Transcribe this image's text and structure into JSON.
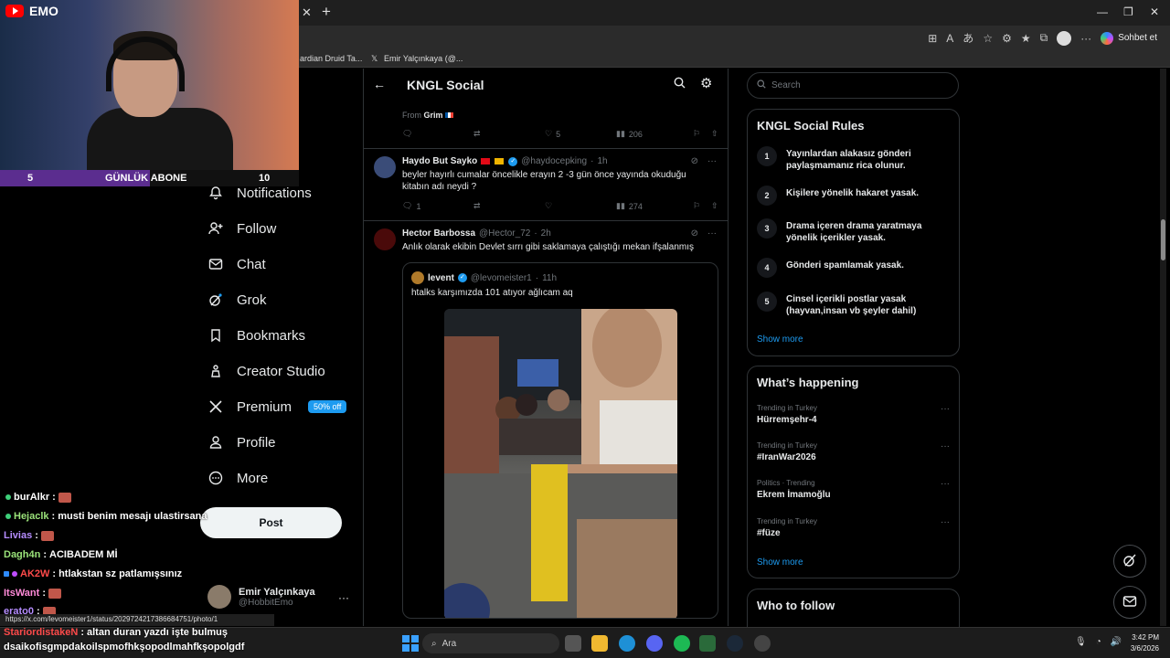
{
  "browser": {
    "tabs": [
      {
        "label": "ardian Druid Ta..."
      },
      {
        "label": "Emir Yalçınkaya (@..."
      }
    ],
    "copilot_label": "Sohbet et",
    "status_url": "https://x.com/levomeister1/status/2029724217386684751/photo/1"
  },
  "nav": {
    "items": [
      {
        "label": "Notifications",
        "icon": "bell-icon"
      },
      {
        "label": "Follow",
        "icon": "person-plus-icon"
      },
      {
        "label": "Chat",
        "icon": "envelope-icon"
      },
      {
        "label": "Grok",
        "icon": "grok-icon"
      },
      {
        "label": "Bookmarks",
        "icon": "bookmark-icon"
      },
      {
        "label": "Creator Studio",
        "icon": "creator-studio-icon"
      },
      {
        "label": "Premium",
        "icon": "x-logo-icon"
      },
      {
        "label": "Profile",
        "icon": "person-icon"
      },
      {
        "label": "More",
        "icon": "more-circle-icon"
      }
    ],
    "premium_badge": "50% off",
    "post_label": "Post",
    "account": {
      "name": "Emir Yalçınkaya",
      "handle": "@HobbitEmo"
    }
  },
  "header": {
    "title": "KNGL Social"
  },
  "feed": {
    "prev_from_label": "From",
    "prev_from_name": "Grim",
    "prev_actions": {
      "replies": "",
      "reposts": "",
      "likes": "5",
      "views": "206"
    },
    "tweets": [
      {
        "name": "Haydo But Sayko",
        "handle": "@haydocepking",
        "time": "1h",
        "text": "beyler hayırlı cumalar öncelikle erayın 2 -3 gün önce yayında okuduğu kitabın adı neydi ?",
        "replies": "1",
        "reposts": "",
        "likes": "",
        "views": "274"
      },
      {
        "name": "Hector Barbossa",
        "handle": "@Hector_72",
        "time": "2h",
        "text": "Anlık olarak ekibin Devlet sırrı gibi saklamaya çalıştığı mekan ifşalanmış",
        "quote": {
          "name": "levent",
          "handle": "@levomeister1",
          "time": "11h",
          "text": "htalks karşımızda 101 atıyor ağlıcam aq"
        }
      }
    ]
  },
  "right": {
    "search_placeholder": "Search",
    "rules": {
      "title": "KNGL Social Rules",
      "items": [
        {
          "num": "1",
          "text": "Yayınlardan alakasız gönderi paylaşmamanız rica olunur."
        },
        {
          "num": "2",
          "text": "Kişilere yönelik hakaret yasak."
        },
        {
          "num": "3",
          "text": "Drama içeren drama yaratmaya yönelik içerikler yasak."
        },
        {
          "num": "4",
          "text": "Gönderi spamlamak yasak."
        },
        {
          "num": "5",
          "text": "Cinsel içerikli postlar yasak (hayvan,insan vb şeyler dahil)"
        }
      ],
      "show_more": "Show more"
    },
    "happening": {
      "title": "What’s happening",
      "trends": [
        {
          "meta": "Trending in Turkey",
          "name": "Hürremşehr-4"
        },
        {
          "meta": "Trending in Turkey",
          "name": "#IranWar2026"
        },
        {
          "meta": "Politics · Trending",
          "name": "Ekrem İmamoğlu"
        },
        {
          "meta": "Trending in Turkey",
          "name": "#füze"
        }
      ],
      "show_more": "Show more"
    },
    "who_to_follow": {
      "title": "Who to follow"
    }
  },
  "stream": {
    "channel": "EMO",
    "sub_goal": {
      "current": "5",
      "label": "GÜNLÜK ABONE",
      "target": "10",
      "progress": 0.5
    },
    "chat": [
      {
        "user": "burAlkr",
        "user_color": "#ffffff",
        "msg": ""
      },
      {
        "user": "Hejaclk",
        "user_color": "#9be37a",
        "msg": "musti benim mesajı ulastirsana"
      },
      {
        "user": "Livias",
        "user_color": "#b58cff",
        "msg": ""
      },
      {
        "user": "Dagh4n",
        "user_color": "#9be37a",
        "msg": "ACIBADEM Mİ"
      },
      {
        "user": "AK2W",
        "user_color": "#ff4a4a",
        "msg": "htlakstan sz patlamışsınız"
      },
      {
        "user": "ItsWant",
        "user_color": "#ff8ad8",
        "msg": ""
      },
      {
        "user": "erato0",
        "user_color": "#b58cff",
        "msg": ""
      },
      {
        "user": "StariordistakeN",
        "user_color": "#ff4a4a",
        "msg": "altan duran yazdı işte bulmuş"
      },
      {
        "user": "",
        "user_color": "#ffffff",
        "msg": "dsaikofisgmpdakoilspmofhkşopodlmahfkşopolgdf"
      }
    ]
  },
  "taskbar": {
    "search_placeholder": "Ara",
    "time": "3:42 PM",
    "date": "3/6/2026"
  }
}
